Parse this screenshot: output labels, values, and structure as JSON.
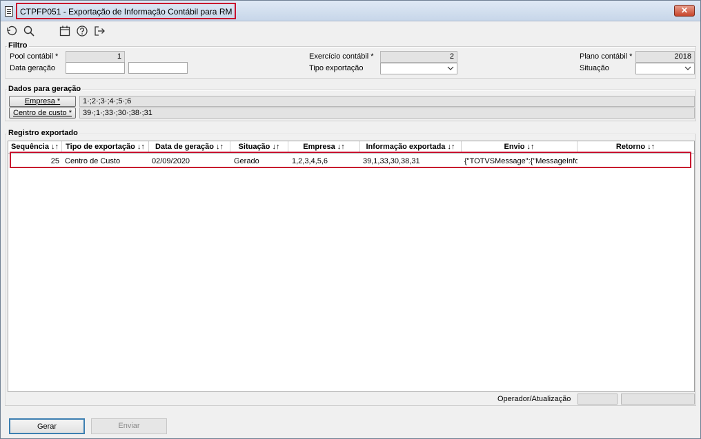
{
  "window": {
    "title": "CTPFP051 - Exportação de Informação Contábil para RM",
    "close_label": "✕"
  },
  "toolbar": {
    "icons": [
      "undo-icon",
      "search-icon",
      "calendar-icon",
      "help-icon",
      "exit-icon"
    ]
  },
  "filtro": {
    "title": "Filtro",
    "pool_label": "Pool contábil *",
    "pool_value": "1",
    "data_label": "Data geração",
    "data_from": "",
    "data_to": "",
    "exercicio_label": "Exercício contábil *",
    "exercicio_value": "2",
    "tipo_label": "Tipo exportação",
    "tipo_value": "",
    "plano_label": "Plano contábil *",
    "plano_value": "2018",
    "situacao_label": "Situação",
    "situacao_value": ""
  },
  "dados": {
    "title": "Dados para geração",
    "empresa_button": "Empresa *",
    "empresa_value": "1·;2·;3·;4·;5·;6",
    "centro_button": "Centro de custo *",
    "centro_value": "39·;1·;33·;30·;38·;31"
  },
  "registro": {
    "title": "Registro exportado",
    "columns": [
      "Sequência ↓↑",
      "Tipo de exportação ↓↑",
      "Data de geração ↓↑",
      "Situação ↓↑",
      "Empresa ↓↑",
      "Informação exportada ↓↑",
      "Envio ↓↑",
      "Retorno ↓↑"
    ],
    "rows": [
      {
        "sequencia": "25",
        "tipo": "Centro de Custo",
        "data": "02/09/2020",
        "situacao": "Gerado",
        "empresa": "1,2,3,4,5,6",
        "info": "39,1,33,30,38,31",
        "envio": "{\"TOTVSMessage\":{\"MessageInfo",
        "retorno": ""
      }
    ]
  },
  "status": {
    "operador_label": "Operador/Atualização",
    "operador_value": "",
    "atualizacao_value": ""
  },
  "footer": {
    "gerar_label": "Gerar",
    "enviar_label": "Enviar"
  },
  "colors": {
    "highlight": "#c8102e",
    "readonly_bg": "#e3e3e3"
  }
}
